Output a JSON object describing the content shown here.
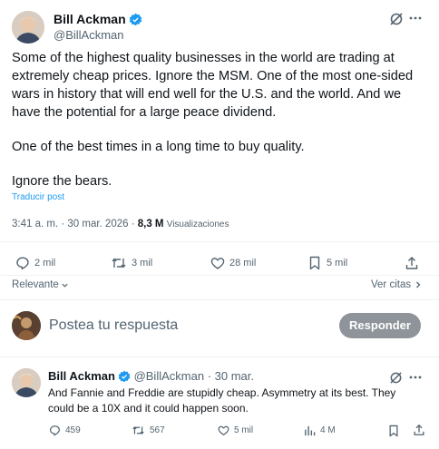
{
  "main_tweet": {
    "author_name": "Bill Ackman",
    "author_handle": "@BillAckman",
    "paragraphs": [
      "Some of the highest quality businesses in the world are trading at extremely cheap prices. Ignore the MSM. One of the most one-sided wars in history that will end well for the U.S. and the world. And we have the potential for a large peace dividend.",
      "One of the best times in a long time to buy quality.",
      "Ignore the bears."
    ],
    "translate_label": "Traducir post",
    "time": "3:41 a. m.",
    "date": "30 mar. 2026",
    "views_count": "8,3 M",
    "views_label": "Visualizaciones",
    "replies": "2 mil",
    "reposts": "3 mil",
    "likes": "28 mil",
    "bookmarks": "5 mil"
  },
  "sort": {
    "relevant_label": "Relevante",
    "quotes_label": "Ver citas"
  },
  "composer": {
    "placeholder": "Postea tu respuesta",
    "reply_button": "Responder"
  },
  "reply_tweet": {
    "author_name": "Bill Ackman",
    "author_handle": "@BillAckman",
    "date": "30 mar.",
    "text": "And Fannie and Freddie are stupidly cheap. Asymmetry at its best. They could be a 10X and it could happen soon.",
    "replies": "459",
    "reposts": "567",
    "likes": "5 mil",
    "views": "4 M"
  },
  "colors": {
    "verified": "#1d9bf0",
    "link": "#1d9bf0",
    "muted": "#536471",
    "reply_button_bg": "#8e9499"
  },
  "icons": [
    "verified-badge-icon",
    "grok-icon",
    "more-icon",
    "reply-icon",
    "repost-icon",
    "like-icon",
    "bookmark-icon",
    "share-icon",
    "views-icon",
    "chevron-down-icon",
    "chevron-right-icon"
  ]
}
